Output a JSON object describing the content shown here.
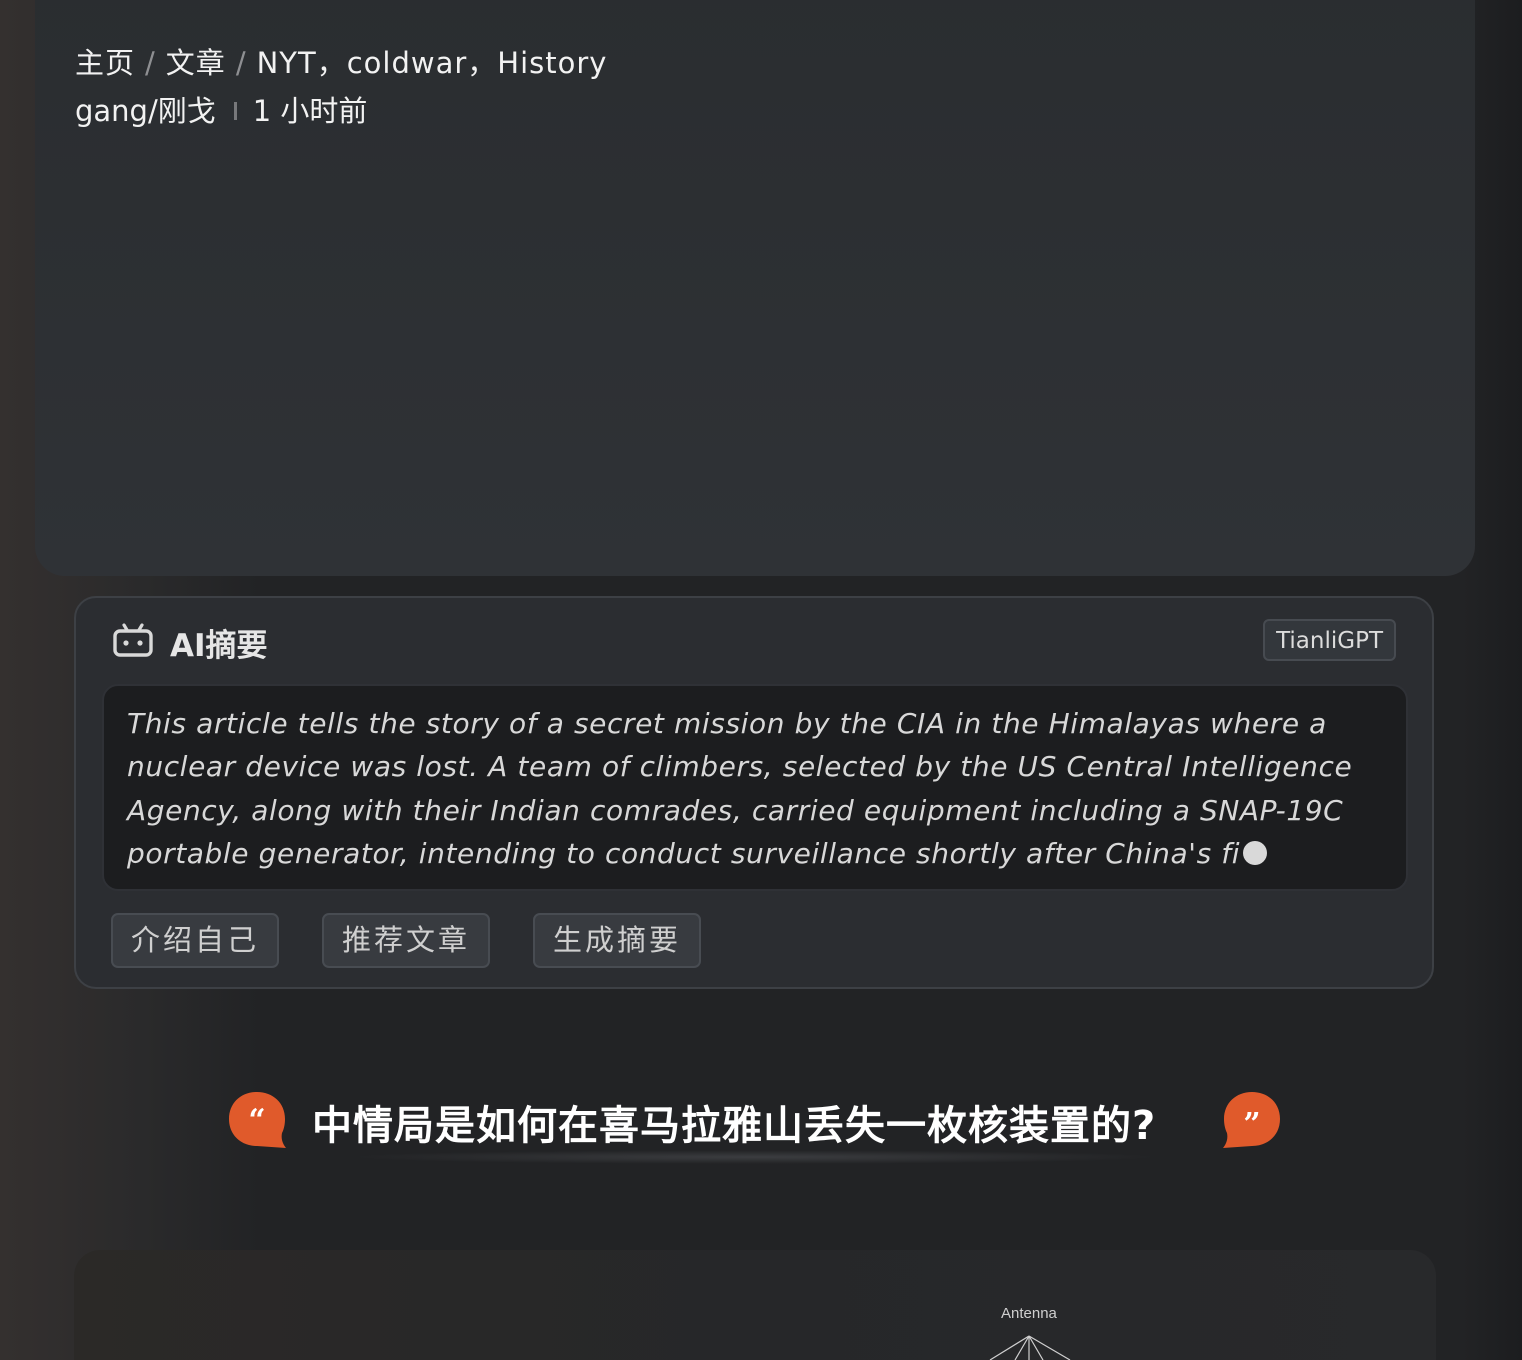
{
  "breadcrumb": {
    "items": [
      "主页",
      "文章",
      "NYT，coldwar，History"
    ],
    "separator": "/"
  },
  "post_meta": {
    "author": "gang/刚戈",
    "time": "1 小时前"
  },
  "ai_summary": {
    "title": "AI摘要",
    "badge": "TianliGPT",
    "text": "This article tells the story of a secret mission by the CIA in the Himalayas where a nuclear device was lost. A team of climbers, selected by the US Central Intelligence Agency, along with their Indian comrades, carried equipment including a SNAP-19C portable generator, intending to conduct surveillance shortly after China's fi",
    "buttons": [
      "介绍自己",
      "推荐文章",
      "生成摘要"
    ]
  },
  "article": {
    "heading": "中情局是如何在喜马拉雅山丢失一枚核装置的?",
    "figure_label": "Antenna"
  },
  "colors": {
    "accent": "#e05a2b",
    "background": "#222325",
    "card": "#2b2d31"
  },
  "icons": {
    "ai": "robot-icon",
    "quote_open": "quote-open-icon",
    "quote_close": "quote-close-icon"
  }
}
